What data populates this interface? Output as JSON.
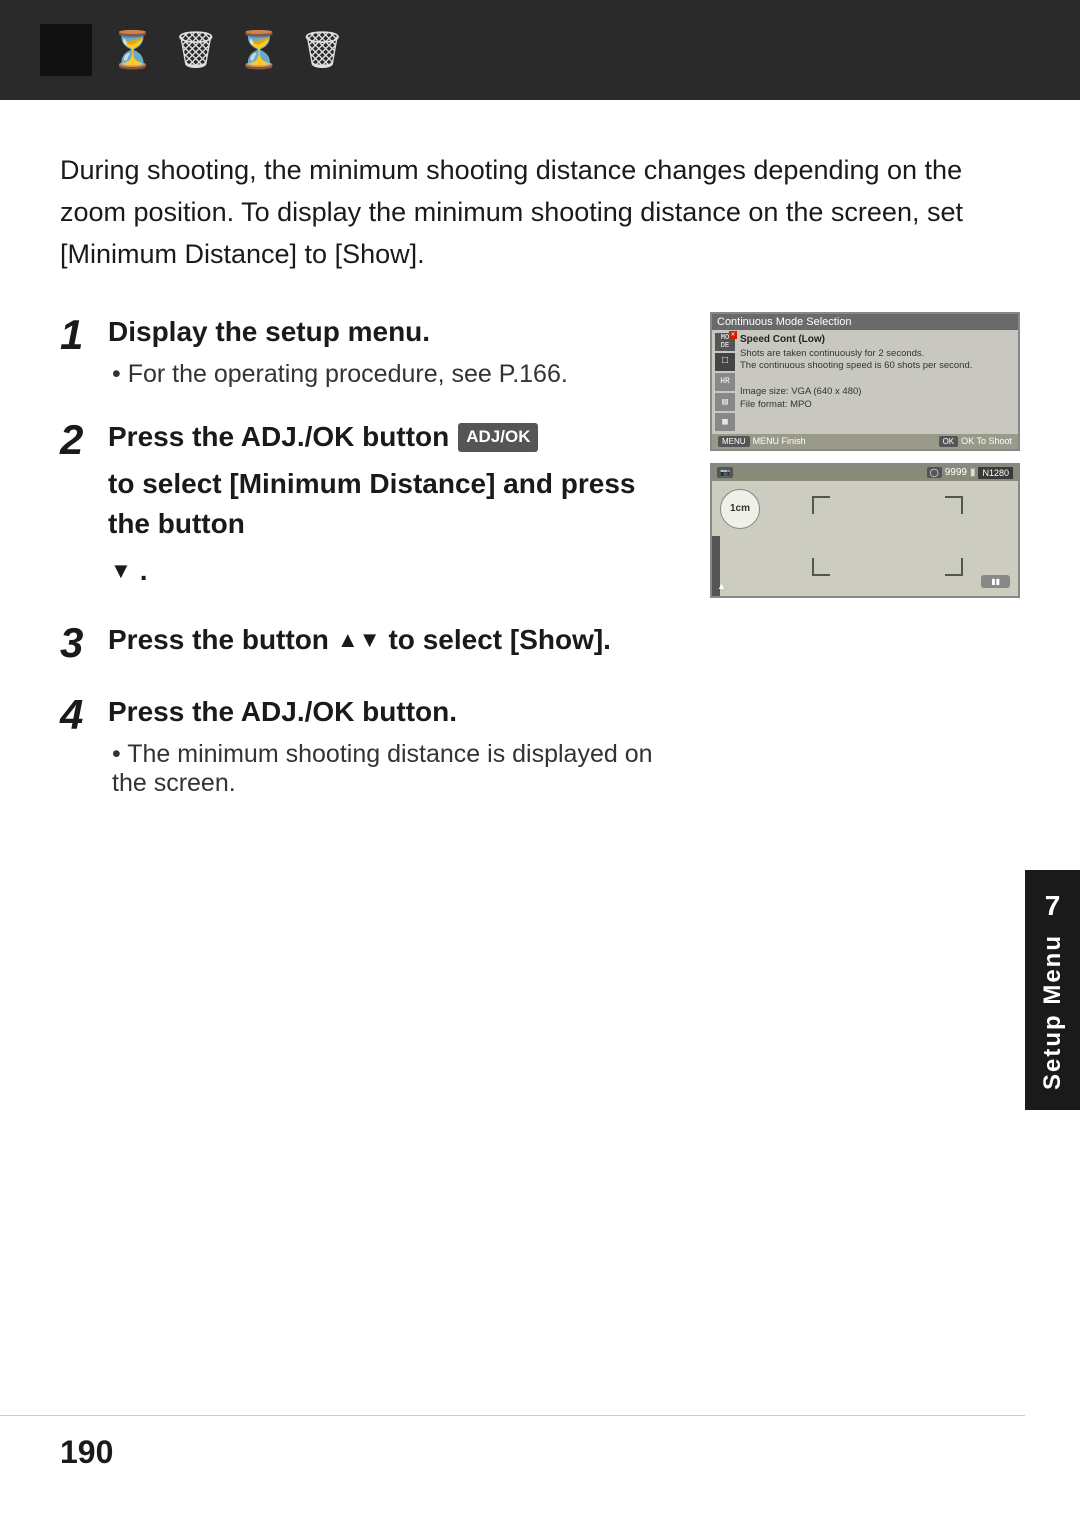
{
  "header": {
    "icons": [
      "⏱",
      "🗑",
      "⏱",
      "🗑"
    ]
  },
  "intro": {
    "text": "During shooting, the minimum shooting distance changes depending on the zoom position. To display the minimum shooting distance on the screen, set [Minimum Distance] to [Show]."
  },
  "steps": [
    {
      "number": "1",
      "title": "Display the setup menu.",
      "bullet": "For the operating procedure, see P.166."
    },
    {
      "number": "2",
      "title_part1": "Press the ADJ./OK button",
      "title_part2": "to select [Minimum Distance] and press the button",
      "title_part3": "."
    },
    {
      "number": "3",
      "title_part1": "Press the button",
      "title_part2": "to select [Show]."
    },
    {
      "number": "4",
      "title": "Press the ADJ./OK button.",
      "bullet": "The minimum shooting distance is displayed on the screen."
    }
  ],
  "screen_top": {
    "title": "Continuous Mode Selection",
    "menu_items": [
      "MO/DE",
      "▣",
      "HR",
      "▤",
      "▧"
    ],
    "detail_title": "Speed Cont (Low)",
    "detail_body": "Shots are taken continuously for 2 seconds.\nThe continuous shooting speed is 60 shots per second.\n\nImage size: VGA (640 x 480)\nFile format: MPO",
    "footer_left": "MENU Finish",
    "footer_right": "OK To Shoot"
  },
  "screen_bottom": {
    "count": "9999",
    "mode": "N1280",
    "label_1cm": "1cm"
  },
  "side_tab": {
    "number": "7",
    "text": "Setup Menu"
  },
  "page_number": "190"
}
